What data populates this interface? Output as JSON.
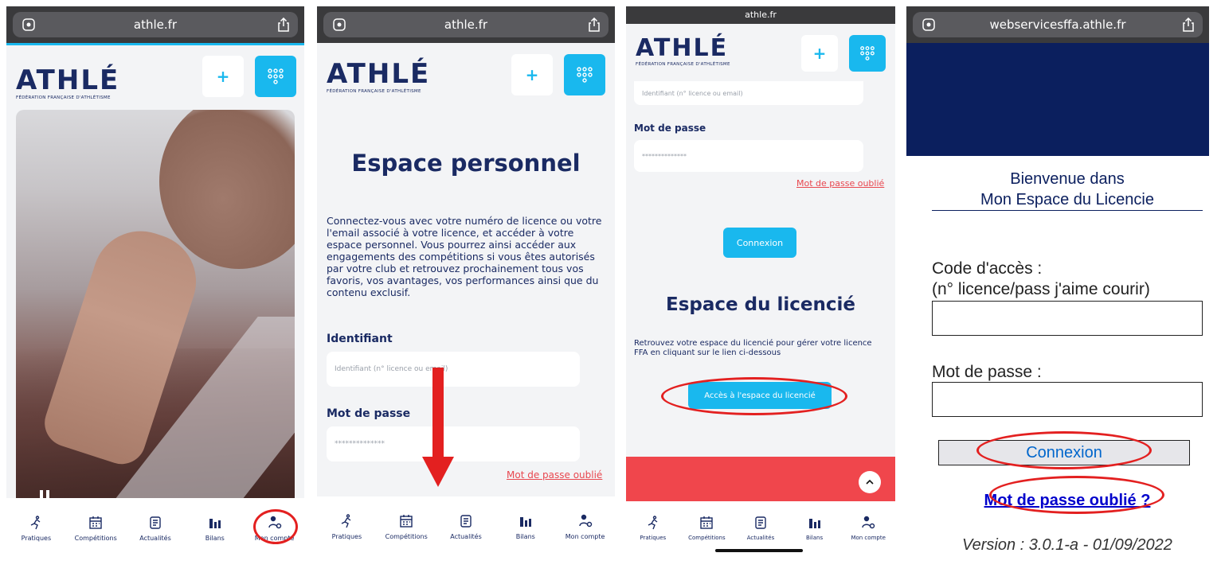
{
  "panel1": {
    "url": "athle.fr",
    "logo_word": "ATHLÉ",
    "logo_sub": "FÉDÉRATION FRANÇAISE D'ATHLÉTISME",
    "plus_glyph": "+",
    "hero_icon": "pause-icon"
  },
  "panel2": {
    "url": "athle.fr",
    "logo_word": "ATHLÉ",
    "logo_sub": "FÉDÉRATION FRANÇAISE D'ATHLÉTISME",
    "plus_glyph": "+",
    "title": "Espace personnel",
    "description": "Connectez-vous avec votre numéro de licence ou votre l'email associé à votre licence, et accéder à votre espace personnel. Vous pourrez ainsi accéder aux engagements des compétitions si vous êtes autorisés par votre club et retrouvez prochainement tous vos favoris, vos avantages, vos performances ainsi que du contenu exclusif.",
    "id_label": "Identifiant",
    "id_placeholder": "Identifiant (n° licence ou email)",
    "pw_label": "Mot de passe",
    "pw_placeholder": "**************",
    "forgot": "Mot de passe oublié"
  },
  "panel3": {
    "url": "athle.fr",
    "logo_word": "ATHLÉ",
    "logo_sub": "FÉDÉRATION FRANÇAISE D'ATHLÉTISME",
    "plus_glyph": "+",
    "id_placeholder": "Identifiant (n° licence ou email)",
    "pw_label": "Mot de passe",
    "pw_placeholder": "**************",
    "forgot": "Mot de passe oublié",
    "login": "Connexion",
    "title": "Espace du licencié",
    "description": "Retrouvez votre espace du licencié pour gérer votre licence FFA en cliquant sur le lien ci-dessous",
    "access_button": "Accès à l'espace du licencié"
  },
  "panel4": {
    "url": "webservicesffa.athle.fr",
    "welcome_line1": "Bienvenue dans",
    "welcome_line2": "Mon Espace du Licencie",
    "code_label_line1": "Code d'accès :",
    "code_label_line2": "(n° licence/pass j'aime courir)",
    "pw_label": "Mot de passe :",
    "login": "Connexion",
    "forgot": "Mot de passe oublié ?",
    "version": "Version : 3.0.1-a - 01/09/2022"
  },
  "tabs": [
    {
      "label": "Pratiques",
      "icon": "runner-icon"
    },
    {
      "label": "Compétitions",
      "icon": "calendar-icon"
    },
    {
      "label": "Actualités",
      "icon": "news-icon"
    },
    {
      "label": "Bilans",
      "icon": "bar-chart-icon"
    },
    {
      "label": "Mon compte",
      "icon": "user-check-icon"
    }
  ],
  "colors": {
    "navy": "#1a2a63",
    "accent_blue": "#19b8ee",
    "link_red": "#e8474f",
    "footer_red": "#f0464c",
    "highlight_red": "#e32020",
    "legacy_navy": "#0b1f5e"
  }
}
